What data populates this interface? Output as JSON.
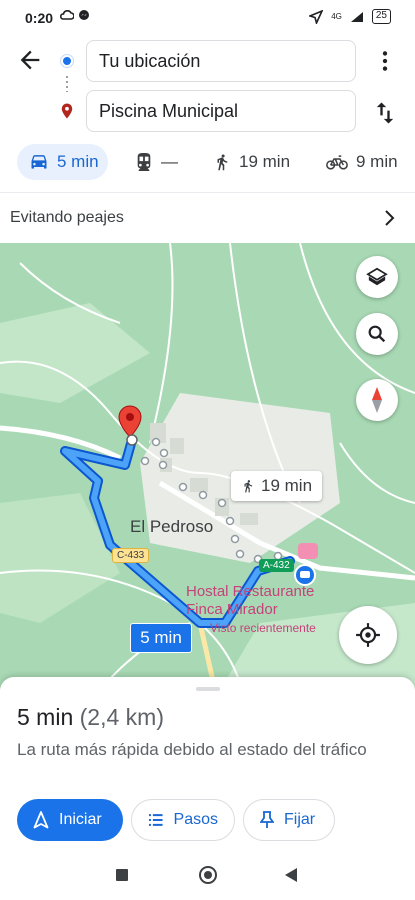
{
  "status_bar": {
    "time": "0:20",
    "left_icons": [
      "cloud-icon",
      "messenger-icon"
    ],
    "network": "4G",
    "battery": "25"
  },
  "route": {
    "origin": "Tu ubicación",
    "destination": "Piscina Municipal"
  },
  "modes": {
    "drive": "5 min",
    "transit": "—",
    "walk": "19 min",
    "bike": "9 min"
  },
  "options": {
    "tolls": "Evitando peajes"
  },
  "map": {
    "town": "El Pedroso",
    "walk_label": "19 min",
    "road_c433": "C-433",
    "road_a432": "A-432",
    "poi_name": "Hostal Restaurante Finca Mirador",
    "poi_sub": "Visto recientemente",
    "route_time": "5 min",
    "colors": {
      "route": "#1a73e8",
      "map_bg": "#a8d9b4",
      "poi": "#c5427a"
    }
  },
  "sheet": {
    "time": "5 min",
    "distance": "(2,4 km)",
    "reason": "La ruta más rápida debido al estado del tráfico",
    "buttons": {
      "start": "Iniciar",
      "steps": "Pasos",
      "pin": "Fijar"
    }
  }
}
